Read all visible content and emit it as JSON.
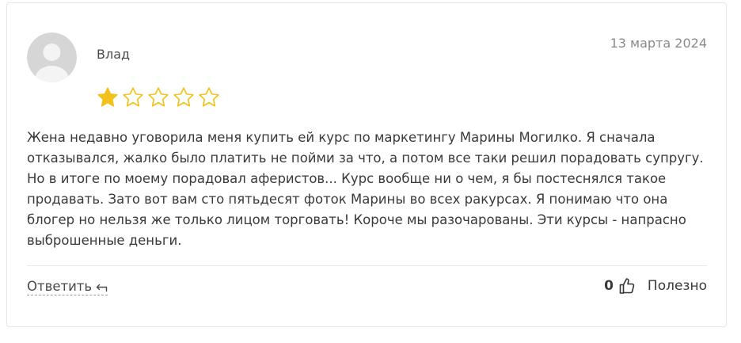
{
  "review": {
    "author": "Влад",
    "date": "13 марта 2024",
    "rating": 1,
    "max_rating": 5,
    "text": "Жена недавно уговорила меня купить ей курс по маркетингу Марины Могилко. Я сначала отказывался, жалко было платить не пойми за что, а потом все таки решил порадовать супругу. Но в итоге по моему порадовал аферистов... Курс вообще ни о чем, я бы постеснялся такое продавать. Зато вот вам сто пятьдесят фоток Марины во всех ракурсах. Я понимаю что она блогер но нельзя же только лицом торговать! Короче мы разочарованы. Эти курсы - напрасно выброшенные деньги."
  },
  "actions": {
    "reply_label": "Ответить",
    "helpful_count": "0",
    "helpful_label": "Полезно"
  },
  "colors": {
    "star_filled": "#f2c21b",
    "star_outline": "#f2c21b",
    "avatar_bg": "#d6d6d6",
    "avatar_figure": "#f4f4f4"
  },
  "icons": {
    "avatar": "user-placeholder-icon",
    "rating": "star-icon",
    "reply": "reply-arrow-icon",
    "helpful": "thumbs-up-icon"
  }
}
